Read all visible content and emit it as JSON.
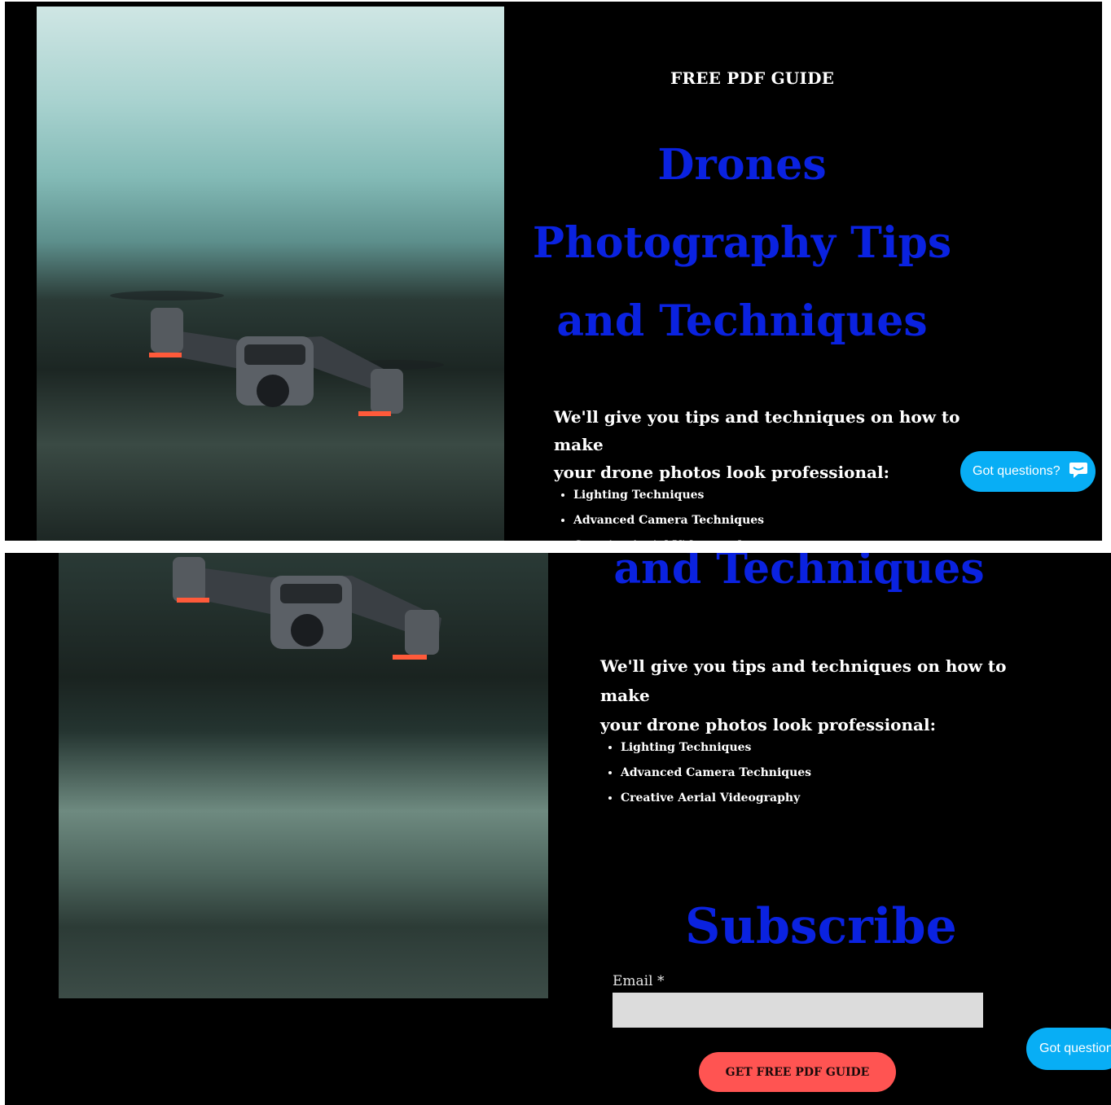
{
  "view1": {
    "eyebrow": "FREE PDF GUIDE",
    "headline": [
      "Drones",
      "Photography Tips",
      "and Techniques"
    ],
    "intro": [
      "We'll give you tips and techniques on how to make",
      "your drone photos look professional:"
    ],
    "bullets": [
      "Lighting Techniques",
      "Advanced Camera Techniques",
      "Creative Aerial Videography"
    ],
    "chat": {
      "label": "Got questions?",
      "icon": "chat-bubble-icon"
    }
  },
  "view2": {
    "headline_tail": "and Techniques",
    "intro": [
      "We'll give you tips and techniques on how to make",
      "your drone photos look professional:"
    ],
    "bullets": [
      "Lighting Techniques",
      "Advanced Camera Techniques",
      "Creative Aerial Videography"
    ],
    "subscribe": {
      "title": "Subscribe",
      "email_label": "Email *",
      "email_value": "",
      "button": "GET FREE PDF GUIDE"
    },
    "chat": {
      "label": "Got questions?"
    }
  },
  "colors": {
    "background": "#000000",
    "headline": "#0a22e0",
    "chat_button": "#08aef5",
    "cta_button": "#ff5452",
    "input": "#dcdcdc"
  }
}
